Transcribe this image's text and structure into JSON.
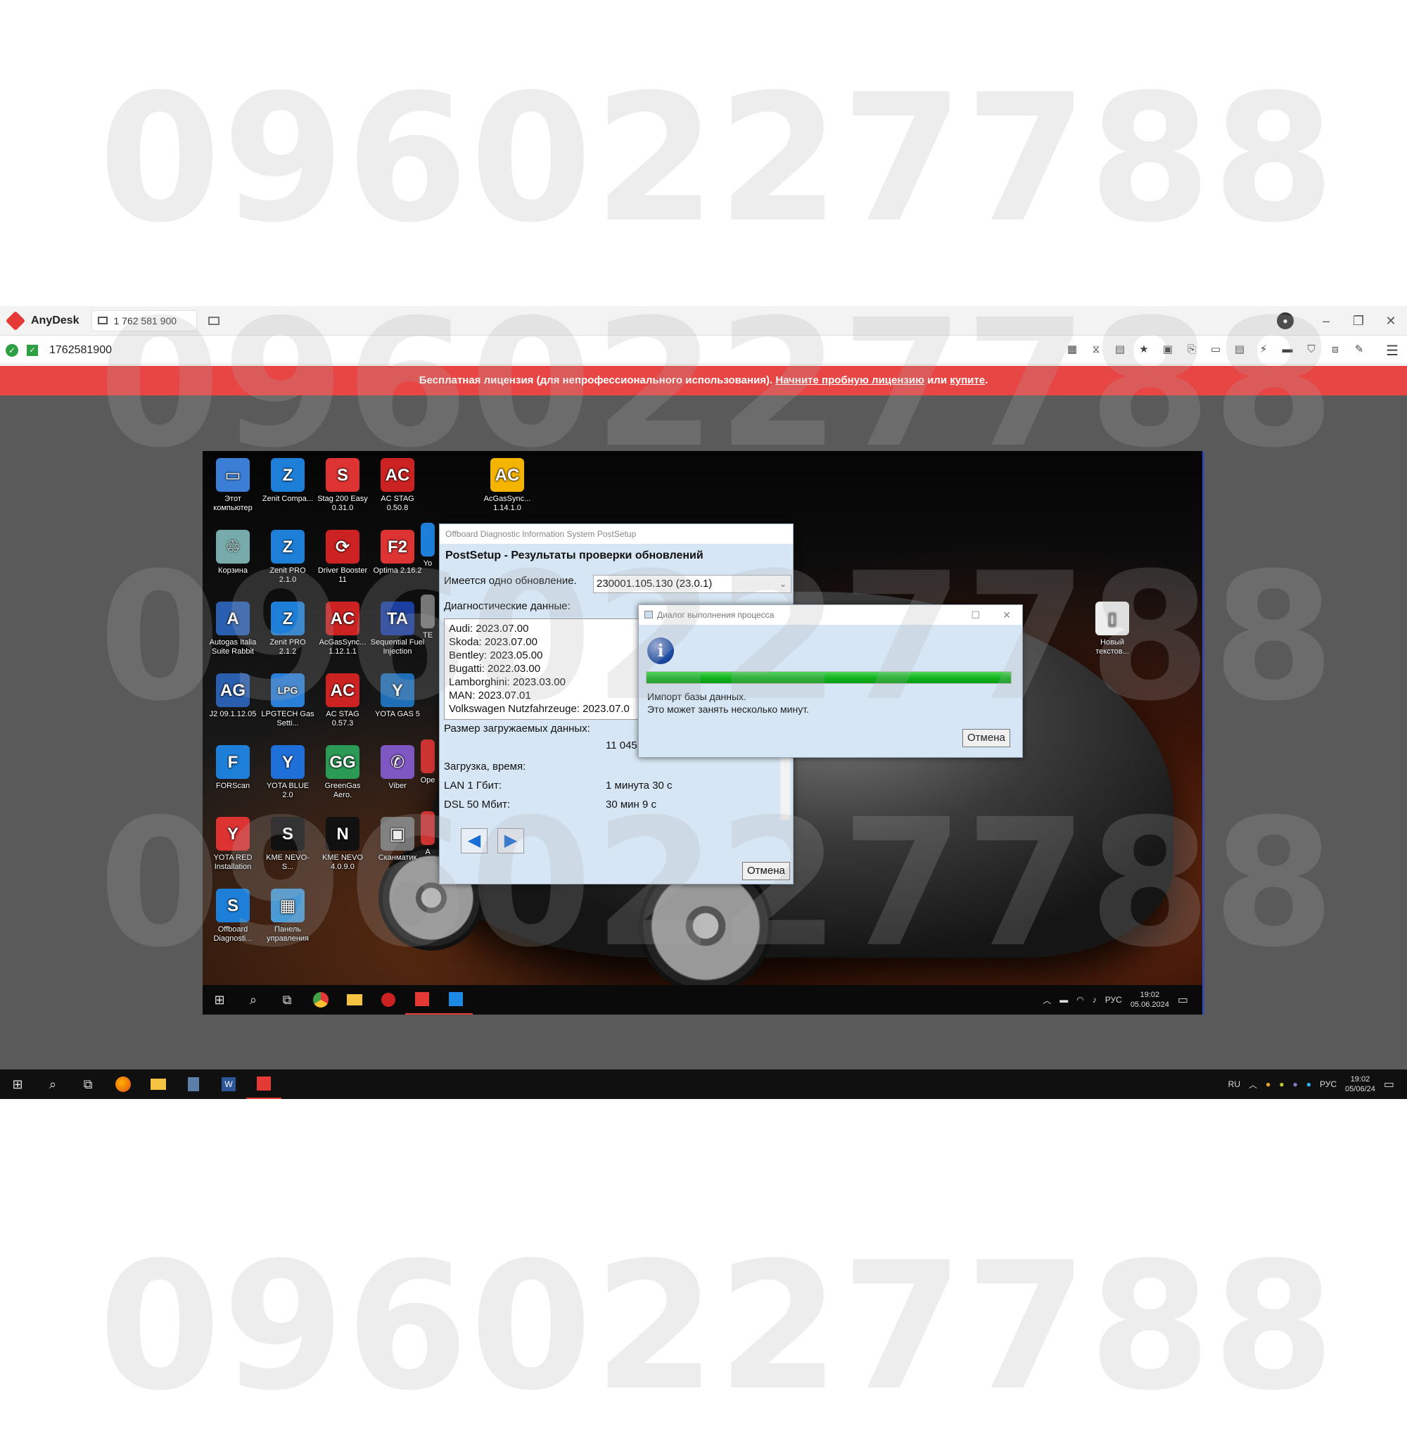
{
  "watermark": {
    "groups": [
      "096",
      "022",
      "77",
      "88"
    ]
  },
  "anydesk": {
    "app_name": "AnyDesk",
    "tab_label": "1 762 581 900",
    "address": "1762581900",
    "min": "–",
    "max": "❐",
    "close": "✕",
    "tools": [
      "▦",
      "⧖",
      "▤",
      "★",
      "▣",
      "⎘",
      "▭",
      "▤",
      "⚡",
      "▬",
      "⛉",
      "⧈",
      "✎"
    ],
    "menu": "☰",
    "banner": {
      "text": "Бесплатная лицензия (для непрофессионального использования). ",
      "link1": "Начните пробную лицензию",
      "mid": " или ",
      "link2": "купите",
      "end": "."
    }
  },
  "desktop": {
    "icons": [
      {
        "label": "Этот компьютер",
        "glyph": "▭",
        "color": "#3a7fd5"
      },
      {
        "label": "Zenit Compa...",
        "glyph": "Z",
        "color": "#1e7fd8"
      },
      {
        "label": "Stag 200 Easy 0.31.0",
        "glyph": "S",
        "color": "#d33"
      },
      {
        "label": "AC STAG 0.50.8",
        "glyph": "AC",
        "color": "#c22"
      },
      {
        "label": "AcGasSync... 1.14.1.0",
        "glyph": "AC",
        "color": "#f5b400"
      },
      {
        "label": "Корзина",
        "glyph": "♲",
        "color": "#7aa"
      },
      {
        "label": "Zenit PRO 2.1.0",
        "glyph": "Z",
        "color": "#1e7fd8"
      },
      {
        "label": "Driver Booster 11",
        "glyph": "⟳",
        "color": "#c22"
      },
      {
        "label": "Optima 2.16.2",
        "glyph": "F2",
        "color": "#d33"
      },
      {
        "label": "Autogas Italia Suite Rabbit",
        "glyph": "A",
        "color": "#2a5fb0"
      },
      {
        "label": "Zenit PRO 2.1.2",
        "glyph": "Z",
        "color": "#1e7fd8"
      },
      {
        "label": "AcGasSync... 1.12.1.1",
        "glyph": "AC",
        "color": "#c22"
      },
      {
        "label": "Sequential Fuel Injection",
        "glyph": "TA",
        "color": "#1b3fa0"
      },
      {
        "label": "J2 09.1.12.05",
        "glyph": "AG",
        "color": "#2a5fb0"
      },
      {
        "label": "LPGTECH Gas Setti...",
        "glyph": "LPG",
        "color": "#2a7fd8"
      },
      {
        "label": "AC STAG 0.57.3",
        "glyph": "AC",
        "color": "#c22"
      },
      {
        "label": "YOTA GAS 5",
        "glyph": "Y",
        "color": "#1e6fb8"
      },
      {
        "label": "FORScan",
        "glyph": "F",
        "color": "#1e7fd8"
      },
      {
        "label": "YOTA BLUE 2.0",
        "glyph": "Y",
        "color": "#1e6fd8"
      },
      {
        "label": "GreenGas Aero.",
        "glyph": "GG",
        "color": "#2a9a55"
      },
      {
        "label": "Viber",
        "glyph": "✆",
        "color": "#7e57c2"
      },
      {
        "label": "YOTA RED Installation",
        "glyph": "Y",
        "color": "#d33"
      },
      {
        "label": "KME NEVO-S...",
        "glyph": "S",
        "color": "#111"
      },
      {
        "label": "KME NEVO 4.0.9.0",
        "glyph": "N",
        "color": "#111"
      },
      {
        "label": "Сканматик",
        "glyph": "▣",
        "color": "#777"
      },
      {
        "label": "Offboard Diagnosti...",
        "glyph": "S",
        "color": "#1e7fd8"
      },
      {
        "label": "Панель управления",
        "glyph": "▦",
        "color": "#4a9ad5"
      },
      {
        "label": "Новый текстов...",
        "glyph": "▯",
        "color": "#eee"
      }
    ],
    "partial_labels": {
      "yo": "Yo",
      "te": "TE",
      "op": "Ope",
      "a": "A"
    },
    "taskbar": {
      "time": "19:02",
      "date": "05.06.2024",
      "lang": "РУС"
    }
  },
  "postsetup": {
    "window_title": "Offboard Diagnostic Information System PostSetup",
    "heading": "PostSetup - Результаты проверки обновлений",
    "update_label": "Имеется одно обновление.",
    "update_value": "230001.105.130 (23.0.1)",
    "diag_label": "Диагностические данные:",
    "diag_items": [
      "Audi: 2023.07.00",
      "Skoda: 2023.07.00",
      "Bentley: 2023.05.00",
      "Bugatti: 2022.03.00",
      "Lamborghini: 2023.03.00",
      "MAN: 2023.07.01",
      "Volkswagen Nutzfahrzeuge: 2023.07.0"
    ],
    "size_label": "Размер загружаемых данных:",
    "size_value": "11 045",
    "time_label": "Загрузка, время:",
    "lan_label": "LAN 1 Гбит:",
    "lan_value": "1 минута 30 с",
    "dsl_label": "DSL 50 Мбит:",
    "dsl_value": "30 мин 9 с",
    "cancel": "Отмена"
  },
  "progress": {
    "title": "Диалог выполнения процесса",
    "line1": "Импорт базы данных.",
    "line2": "Это может занять несколько минут.",
    "percent": 100,
    "cancel": "Отмена"
  },
  "host": {
    "lang": "RU",
    "time": "19:02",
    "date": "05/06/24",
    "kbd": "РУС"
  }
}
